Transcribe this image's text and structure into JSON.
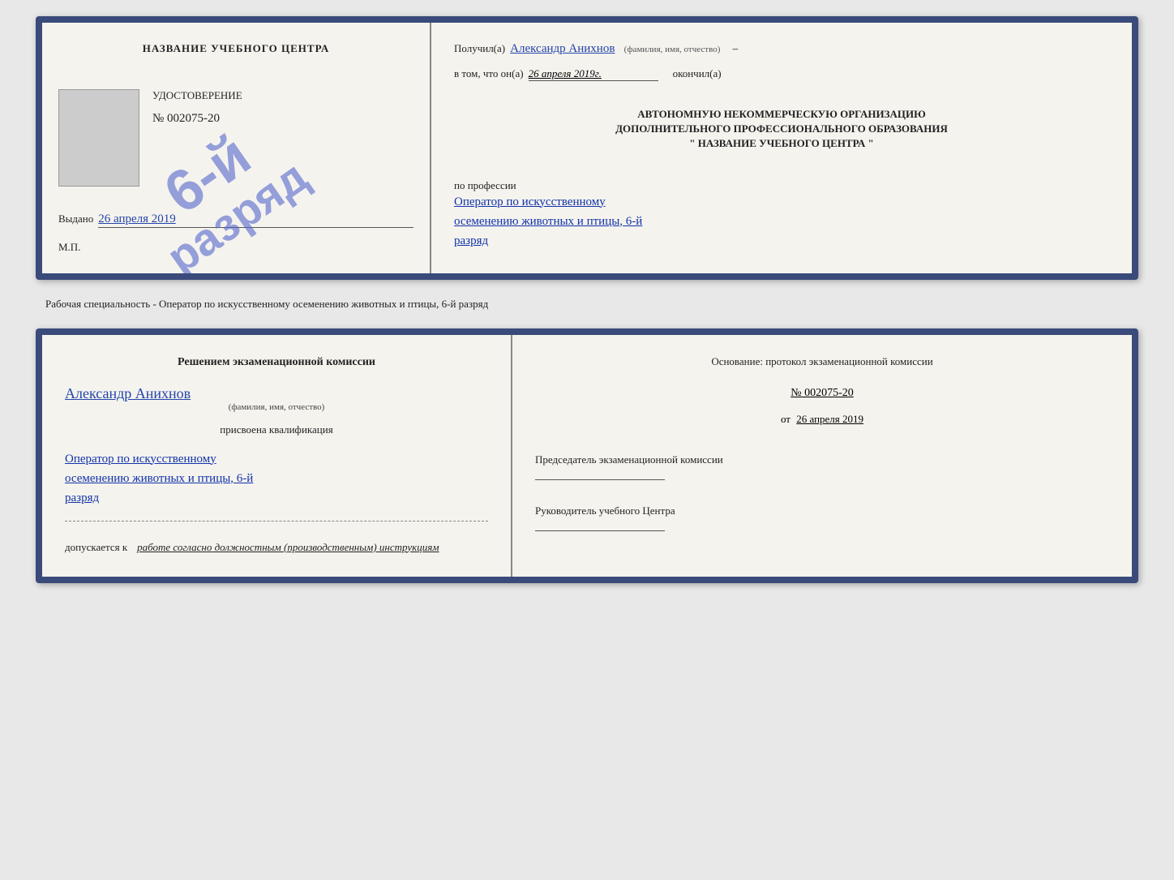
{
  "top_card": {
    "left": {
      "title": "НАЗВАНИЕ УЧЕБНОГО ЦЕНТРА",
      "stamp_line1": "6-й",
      "stamp_line2": "разряд",
      "subtitle": "УДОСТОВЕРЕНИЕ",
      "number": "№ 002075-20",
      "issued_label": "Выдано",
      "issued_date": "26 апреля 2019",
      "mp_label": "М.П."
    },
    "right": {
      "received_label": "Получил(а)",
      "person_name": "Александр Анихнов",
      "name_sublabel": "(фамилия, имя, отчество)",
      "confirm_label": "в том, что он(а)",
      "confirm_date": "26 апреля 2019г.",
      "finished_label": "окончил(а)",
      "org_line1": "АВТОНОМНУЮ НЕКОММЕРЧЕСКУЮ ОРГАНИЗАЦИЮ",
      "org_line2": "ДОПОЛНИТЕЛЬНОГО ПРОФЕССИОНАЛЬНОГО ОБРАЗОВАНИЯ",
      "org_line3": "\"  НАЗВАНИЕ УЧЕБНОГО ЦЕНТРА  \"",
      "profession_label": "по профессии",
      "profession_value": "Оператор по искусственному",
      "profession_value2": "осеменению животных и птицы, 6-й",
      "profession_value3": "разряд"
    }
  },
  "specialty_label": "Рабочая специальность - Оператор по искусственному осеменению животных и птицы, 6-й разряд",
  "bottom_card": {
    "left": {
      "commission_title": "Решением экзаменационной комиссии",
      "person_name": "Александр Анихнов",
      "name_sublabel": "(фамилия, имя, отчество)",
      "assigned_label": "присвоена квалификация",
      "qualification_1": "Оператор по искусственному",
      "qualification_2": "осеменению животных и птицы, 6-й",
      "qualification_3": "разряд",
      "allowed_label": "допускается к",
      "allowed_value": "работе согласно должностным (производственным) инструкциям"
    },
    "right": {
      "basis_label": "Основание: протокол экзаменационной комиссии",
      "protocol_number": "№  002075-20",
      "protocol_date_prefix": "от",
      "protocol_date": "26 апреля 2019",
      "chairman_label": "Председатель экзаменационной комиссии",
      "director_label": "Руководитель учебного Центра"
    }
  }
}
